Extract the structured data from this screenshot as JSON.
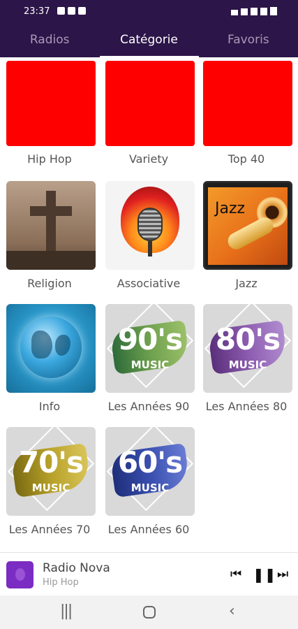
{
  "status_bar": {
    "time": "23:37"
  },
  "tabs": [
    {
      "label": "Radios"
    },
    {
      "label": "Catégorie"
    },
    {
      "label": "Favoris"
    }
  ],
  "active_tab": "Catégorie",
  "categories": [
    {
      "label": "Hip Hop",
      "tile": "red-placeholder"
    },
    {
      "label": "Variety",
      "tile": "red-placeholder"
    },
    {
      "label": "Top 40",
      "tile": "red-placeholder"
    },
    {
      "label": "Religion",
      "tile": "cross-image"
    },
    {
      "label": "Associative",
      "tile": "microphone-flames-image"
    },
    {
      "label": "Jazz",
      "tile": "jazz-trumpet-image",
      "tile_text": "Jazz"
    },
    {
      "label": "Info",
      "tile": "globe-image"
    },
    {
      "label": "Les Années 90",
      "tile": "decade-badge",
      "badge_number": "90's",
      "badge_text": "MUSIC"
    },
    {
      "label": "Les Années 80",
      "tile": "decade-badge",
      "badge_number": "80's",
      "badge_text": "MUSIC"
    },
    {
      "label": "Les Années 70",
      "tile": "decade-badge",
      "badge_number": "70's",
      "badge_text": "MUSIC"
    },
    {
      "label": "Les Années 60",
      "tile": "decade-badge",
      "badge_number": "60's",
      "badge_text": "MUSIC"
    }
  ],
  "player": {
    "station": "Radio Nova",
    "genre": "Hip Hop",
    "controls": [
      "previous-icon",
      "pause-icon",
      "next-icon"
    ]
  },
  "navbar": [
    "recent-apps-icon",
    "home-icon",
    "back-icon"
  ],
  "colors": {
    "header_bg": "#2c1548",
    "tab_inactive": "#a89ab8",
    "placeholder_red": "#ff0000",
    "player_art": "#7b2cc2"
  }
}
